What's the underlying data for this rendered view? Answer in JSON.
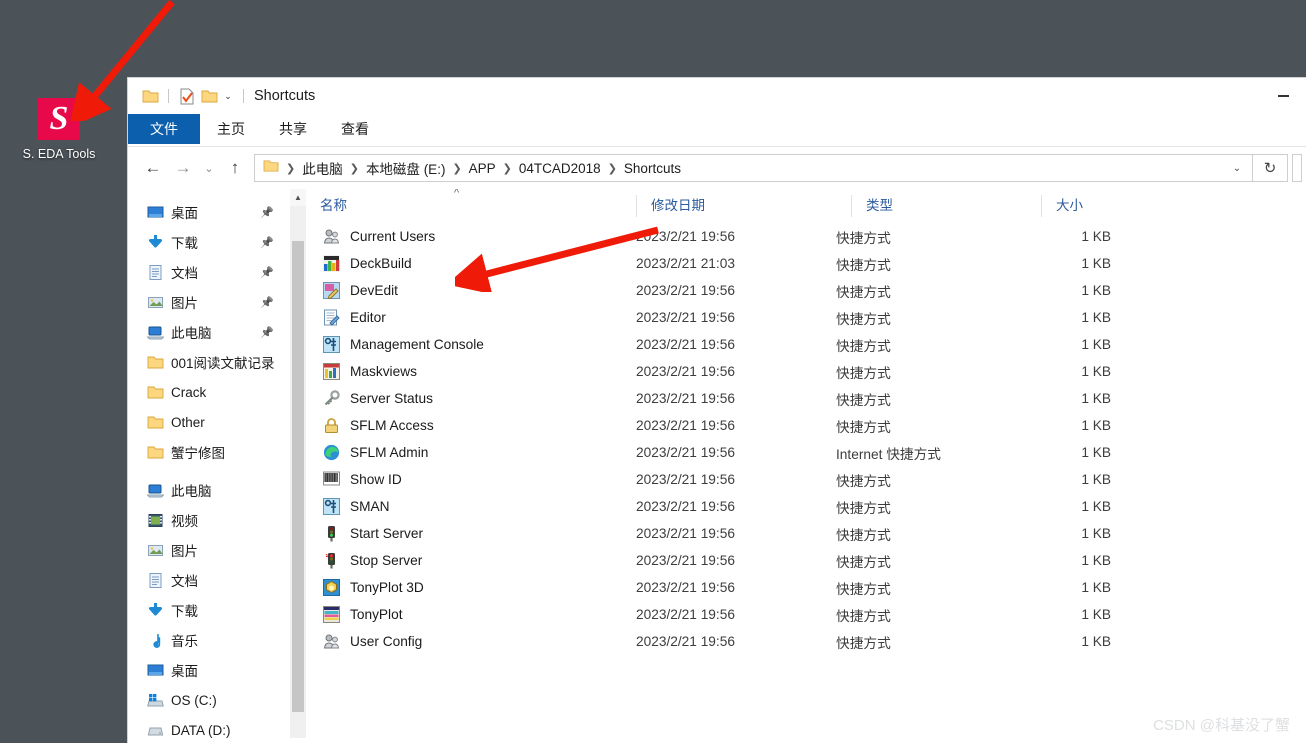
{
  "desktop": {
    "icon": {
      "glyph": "S",
      "label": "S. EDA Tools",
      "color": "#e8094a"
    },
    "background_color": "#4b5258"
  },
  "window": {
    "title": "Shortcuts",
    "quick_access": [
      "folder-icon",
      "properties-icon",
      "new-folder-icon",
      "customize-caret-icon"
    ],
    "minimize_label": "—",
    "ribbon_tabs": [
      {
        "label": "文件",
        "active": true
      },
      {
        "label": "主页",
        "active": false
      },
      {
        "label": "共享",
        "active": false
      },
      {
        "label": "查看",
        "active": false
      }
    ],
    "nav": {
      "back": "←",
      "forward": "→",
      "recent": "⌄",
      "up": "↑",
      "refresh": "↻",
      "address_caret": "⌄"
    },
    "breadcrumb": [
      "此电脑",
      "本地磁盘 (E:)",
      "APP",
      "04TCAD2018",
      "Shortcuts"
    ]
  },
  "sidebar": {
    "quick_access": [
      {
        "label": "桌面",
        "icon": "desktop-icon",
        "pinned": true
      },
      {
        "label": "下载",
        "icon": "download-icon",
        "pinned": true
      },
      {
        "label": "文档",
        "icon": "document-icon",
        "pinned": true
      },
      {
        "label": "图片",
        "icon": "pictures-icon",
        "pinned": true
      },
      {
        "label": "此电脑",
        "icon": "this-pc-icon",
        "pinned": true
      },
      {
        "label": "001阅读文献记录",
        "icon": "folder-icon",
        "pinned": false
      },
      {
        "label": "Crack",
        "icon": "folder-icon",
        "pinned": false
      },
      {
        "label": "Other",
        "icon": "folder-icon",
        "pinned": false
      },
      {
        "label": "蟹宁修图",
        "icon": "folder-icon",
        "pinned": false
      }
    ],
    "this_pc": [
      {
        "label": "此电脑",
        "icon": "this-pc-icon"
      },
      {
        "label": "视频",
        "icon": "videos-icon"
      },
      {
        "label": "图片",
        "icon": "pictures-icon"
      },
      {
        "label": "文档",
        "icon": "document-icon"
      },
      {
        "label": "下载",
        "icon": "download-icon"
      },
      {
        "label": "音乐",
        "icon": "music-icon"
      },
      {
        "label": "桌面",
        "icon": "desktop-icon"
      },
      {
        "label": "OS (C:)",
        "icon": "os-drive-icon"
      },
      {
        "label": "DATA (D:)",
        "icon": "drive-icon"
      }
    ]
  },
  "file_list": {
    "columns": [
      "名称",
      "修改日期",
      "类型",
      "大小"
    ],
    "sort_indicator": "^",
    "rows": [
      {
        "name": "Current Users",
        "icon": "users-icon",
        "date": "2023/2/21 19:56",
        "type": "快捷方式",
        "size": "1 KB"
      },
      {
        "name": "DeckBuild",
        "icon": "deckbuild-icon",
        "date": "2023/2/21 21:03",
        "type": "快捷方式",
        "size": "1 KB"
      },
      {
        "name": "DevEdit",
        "icon": "devedit-icon",
        "date": "2023/2/21 19:56",
        "type": "快捷方式",
        "size": "1 KB"
      },
      {
        "name": "Editor",
        "icon": "editor-icon",
        "date": "2023/2/21 19:56",
        "type": "快捷方式",
        "size": "1 KB"
      },
      {
        "name": "Management Console",
        "icon": "console-icon",
        "date": "2023/2/21 19:56",
        "type": "快捷方式",
        "size": "1 KB"
      },
      {
        "name": "Maskviews",
        "icon": "maskviews-icon",
        "date": "2023/2/21 19:56",
        "type": "快捷方式",
        "size": "1 KB"
      },
      {
        "name": "Server Status",
        "icon": "key-icon",
        "date": "2023/2/21 19:56",
        "type": "快捷方式",
        "size": "1 KB"
      },
      {
        "name": "SFLM Access",
        "icon": "lock-icon",
        "date": "2023/2/21 19:56",
        "type": "快捷方式",
        "size": "1 KB"
      },
      {
        "name": "SFLM Admin",
        "icon": "edge-icon",
        "date": "2023/2/21 19:56",
        "type": "Internet 快捷方式",
        "size": "1 KB"
      },
      {
        "name": "Show ID",
        "icon": "barcode-icon",
        "date": "2023/2/21 19:56",
        "type": "快捷方式",
        "size": "1 KB"
      },
      {
        "name": "SMAN",
        "icon": "console-icon",
        "date": "2023/2/21 19:56",
        "type": "快捷方式",
        "size": "1 KB"
      },
      {
        "name": "Start Server",
        "icon": "traffic-green-icon",
        "date": "2023/2/21 19:56",
        "type": "快捷方式",
        "size": "1 KB"
      },
      {
        "name": "Stop Server",
        "icon": "traffic-red-icon",
        "date": "2023/2/21 19:56",
        "type": "快捷方式",
        "size": "1 KB"
      },
      {
        "name": "TonyPlot 3D",
        "icon": "tonyplot3d-icon",
        "date": "2023/2/21 19:56",
        "type": "快捷方式",
        "size": "1 KB"
      },
      {
        "name": "TonyPlot",
        "icon": "tonyplot-icon",
        "date": "2023/2/21 19:56",
        "type": "快捷方式",
        "size": "1 KB"
      },
      {
        "name": "User Config",
        "icon": "users-icon",
        "date": "2023/2/21 19:56",
        "type": "快捷方式",
        "size": "1 KB"
      }
    ]
  },
  "annotations": {
    "arrow_color": "#f01a08",
    "arrow_count": 2
  },
  "watermark": "CSDN @科基没了蟹"
}
